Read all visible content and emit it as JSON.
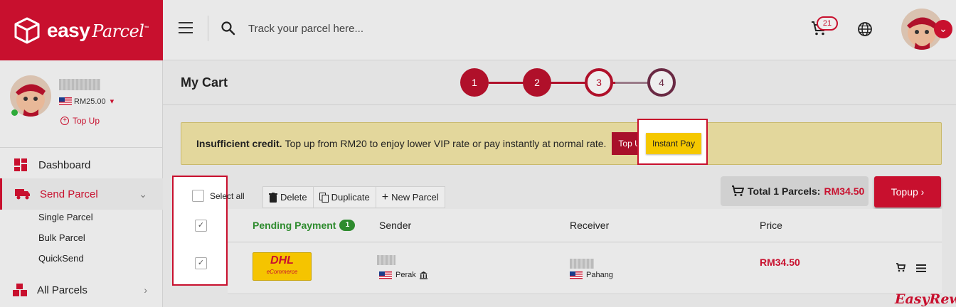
{
  "brand": {
    "name": "easy",
    "script": "Parcel",
    "tm": "™"
  },
  "topbar": {
    "search_placeholder": "Track your parcel here...",
    "cart_count": "21"
  },
  "sidebar": {
    "credit": "RM25.00",
    "topup_link": "Top Up",
    "nav": {
      "dashboard": "Dashboard",
      "send_parcel": "Send Parcel",
      "single": "Single Parcel",
      "bulk": "Bulk Parcel",
      "quicksend": "QuickSend",
      "all_parcels": "All Parcels"
    }
  },
  "main": {
    "title": "My Cart",
    "steps": [
      "1",
      "2",
      "3",
      "4"
    ],
    "alert": {
      "bold": "Insufficient credit.",
      "text": "Top up from RM20 to enjoy lower VIP rate or pay instantly at normal rate.",
      "topup_btn": "Top Up",
      "instant_btn": "Instant Pay"
    },
    "select_all": "Select all",
    "toolbar": {
      "delete": "Delete",
      "duplicate": "Duplicate",
      "new_parcel": "New Parcel"
    },
    "total": {
      "label": "Total 1 Parcels:",
      "amount": "RM34.50"
    },
    "topup_button": "Topup",
    "table": {
      "pending_label": "Pending Payment",
      "pending_count": "1",
      "col_sender": "Sender",
      "col_receiver": "Receiver",
      "col_price": "Price"
    },
    "row": {
      "courier_main": "DHL",
      "courier_sub": "eCommerce",
      "sender_state": "Perak",
      "receiver_state": "Pahang",
      "price": "RM34.50"
    }
  },
  "watermark": "EasyReward",
  "colors": {
    "brand_red": "#c8102e",
    "alert_bg": "#e3d79c",
    "instant_yellow": "#f5c800",
    "pending_green": "#2e8b2e"
  }
}
